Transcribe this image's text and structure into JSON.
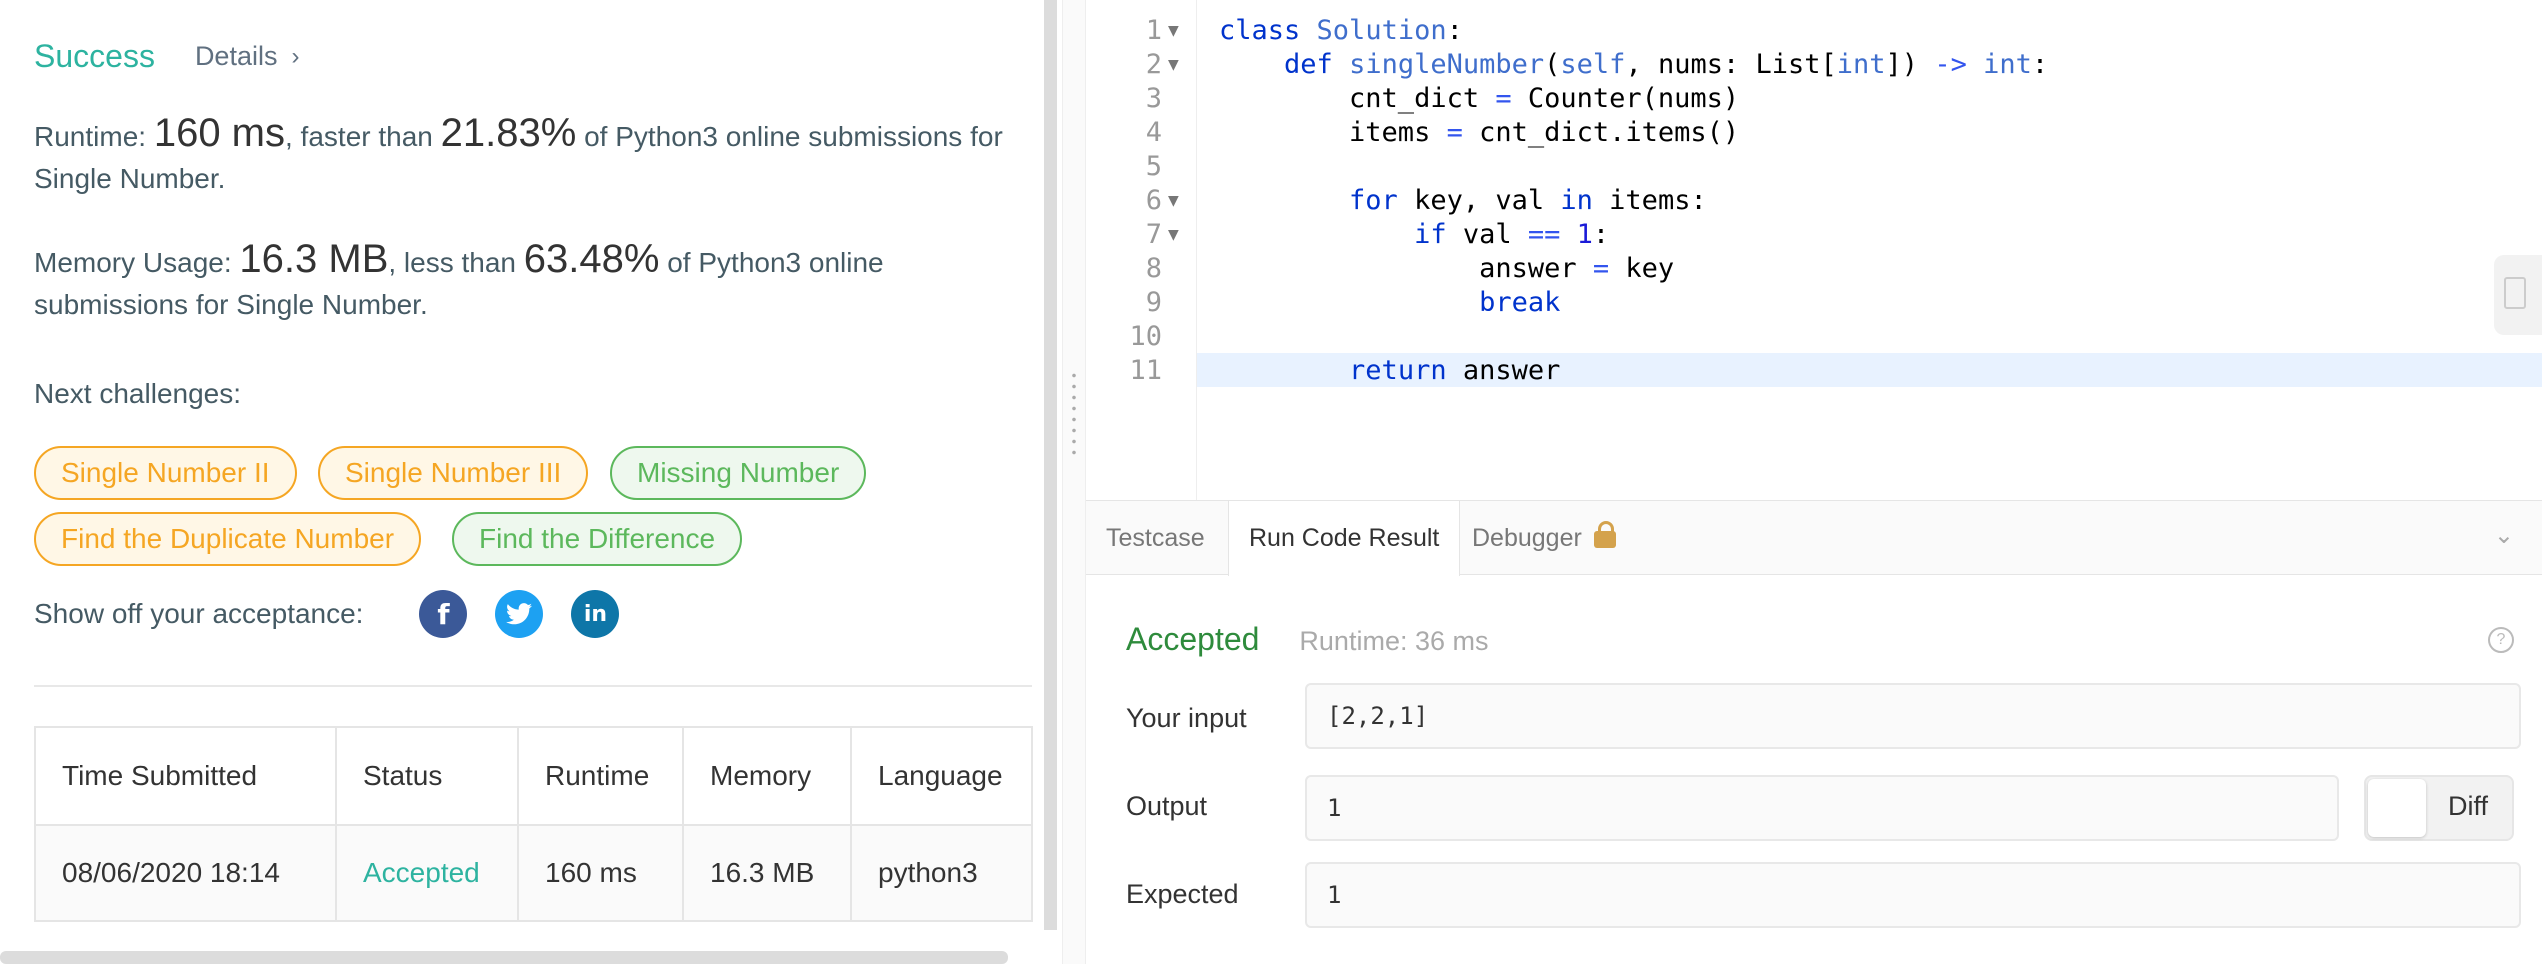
{
  "result": {
    "status": "Success",
    "details_label": "Details",
    "runtime_prefix": "Runtime: ",
    "runtime_value": "160 ms",
    "runtime_mid": ", faster than ",
    "runtime_pct": "21.83%",
    "runtime_suffix": " of Python3 online submissions for Single Number.",
    "memory_prefix": "Memory Usage: ",
    "memory_value": "16.3 MB",
    "memory_mid": ", less than ",
    "memory_pct": "63.48%",
    "memory_suffix": " of Python3 online submissions for Single Number."
  },
  "next_challenges": {
    "title": "Next challenges:",
    "items": [
      {
        "label": "Single Number II",
        "difficulty": "medium"
      },
      {
        "label": "Single Number III",
        "difficulty": "medium"
      },
      {
        "label": "Missing Number",
        "difficulty": "easy"
      },
      {
        "label": "Find the Duplicate Number",
        "difficulty": "medium"
      },
      {
        "label": "Find the Difference",
        "difficulty": "easy"
      }
    ]
  },
  "share": {
    "label": "Show off your acceptance:",
    "icons": [
      "facebook-icon",
      "twitter-icon",
      "linkedin-icon"
    ]
  },
  "submissions": {
    "columns": [
      "Time Submitted",
      "Status",
      "Runtime",
      "Memory",
      "Language"
    ],
    "rows": [
      [
        "08/06/2020 18:14",
        "Accepted",
        "160 ms",
        "16.3 MB",
        "python3"
      ]
    ]
  },
  "editor": {
    "line_numbers": [
      "1",
      "2",
      "3",
      "4",
      "5",
      "6",
      "7",
      "8",
      "9",
      "10",
      "11"
    ],
    "active_line": 11
  },
  "console": {
    "tabs": [
      "Testcase",
      "Run Code Result",
      "Debugger"
    ],
    "active_tab": "Run Code Result",
    "status": "Accepted",
    "runtime": "Runtime: 36 ms",
    "input_label": "Your input",
    "input_value": "[2,2,1]",
    "output_label": "Output",
    "output_value": "1",
    "expected_label": "Expected",
    "expected_value": "1",
    "diff_label": "Diff"
  },
  "colors": {
    "success": "#2db3a0",
    "accepted": "#2e8b3c",
    "medium_chip": "#f5a623",
    "easy_chip": "#5cb85c"
  }
}
